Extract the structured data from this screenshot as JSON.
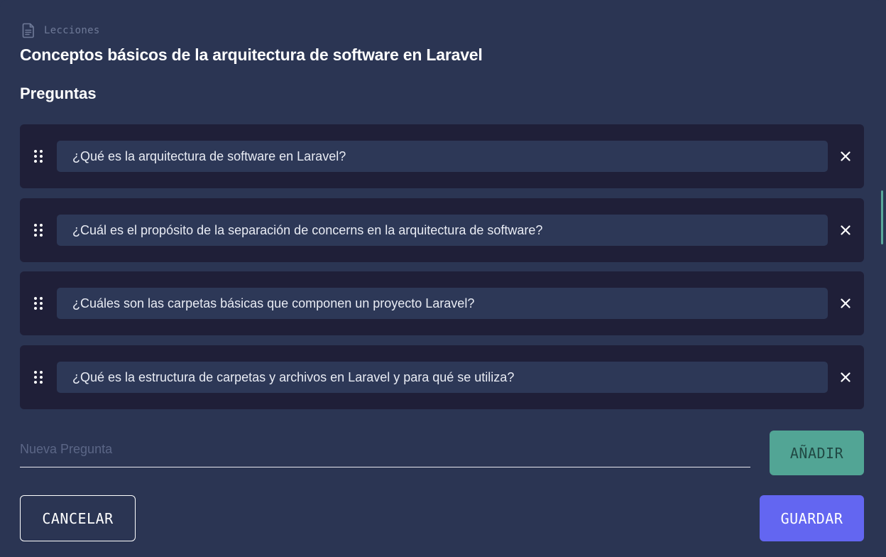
{
  "breadcrumb": {
    "label": "Lecciones",
    "icon": "document-icon"
  },
  "lesson": {
    "title": "Conceptos básicos de la arquitectura de software en Laravel"
  },
  "questions_section": {
    "title": "Preguntas"
  },
  "questions": [
    {
      "text": "¿Qué es la arquitectura de software en Laravel?"
    },
    {
      "text": "¿Cuál es el propósito de la separación de concerns en la arquitectura de software?"
    },
    {
      "text": "¿Cuáles son las carpetas básicas que componen un proyecto Laravel?"
    },
    {
      "text": "¿Qué es la estructura de carpetas y archivos en Laravel y para qué se utiliza?"
    }
  ],
  "new_question": {
    "placeholder": "Nueva Pregunta",
    "value": ""
  },
  "actions": {
    "add_label": "AÑADIR",
    "cancel_label": "CANCELAR",
    "save_label": "GUARDAR"
  },
  "colors": {
    "background": "#2b3553",
    "card": "#1f1f38",
    "field": "#2d3857",
    "add_button": "#52a595",
    "save_button": "#6366f1"
  }
}
